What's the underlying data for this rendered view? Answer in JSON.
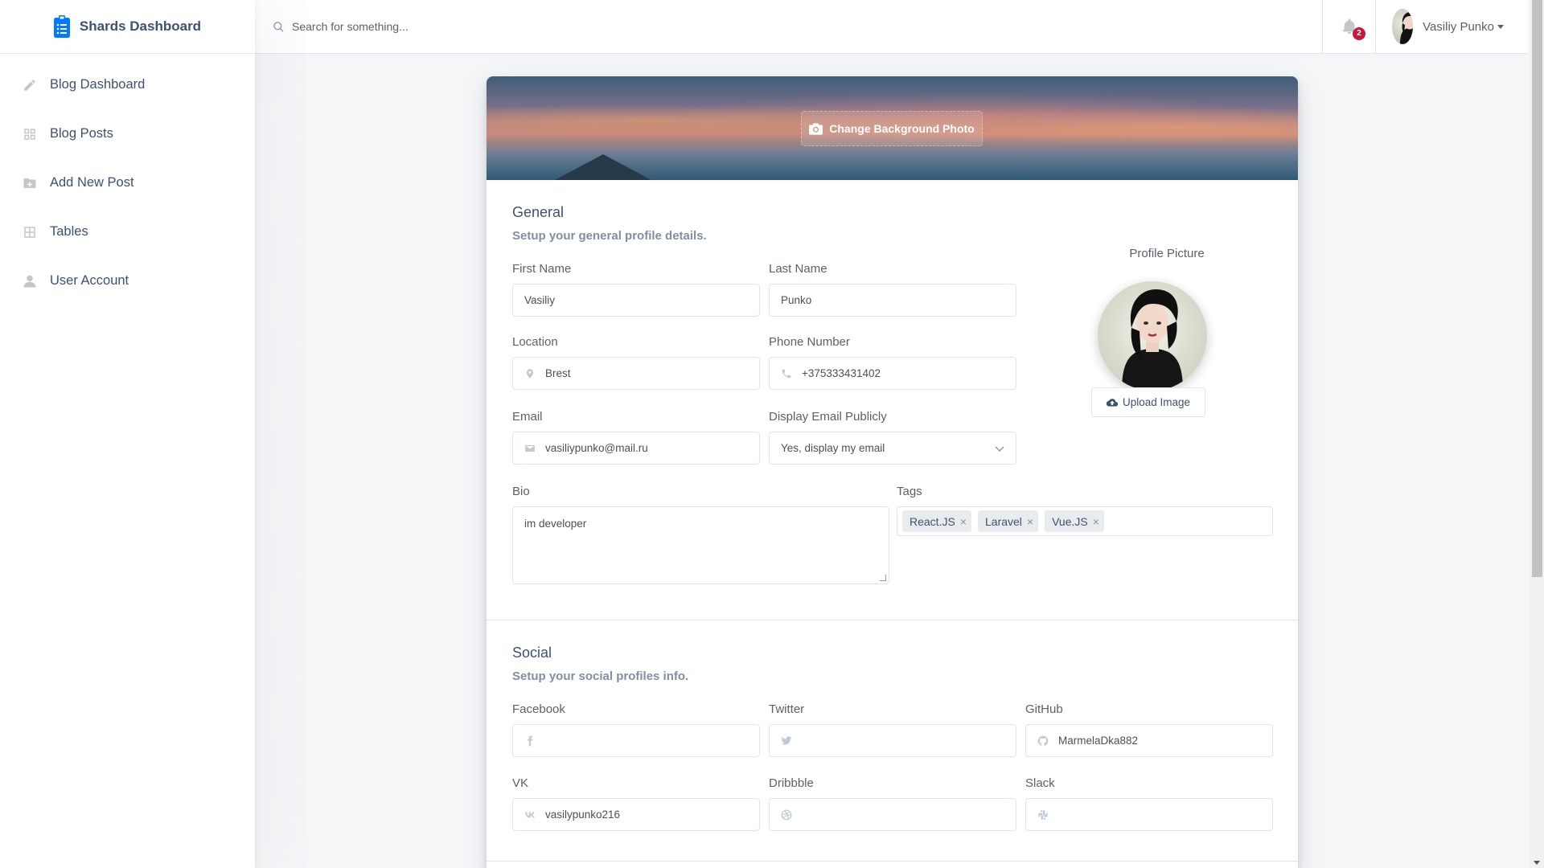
{
  "brand": {
    "name": "Shards Dashboard"
  },
  "sidebar": {
    "items": [
      {
        "label": "Blog Dashboard",
        "icon": "pencil-icon"
      },
      {
        "label": "Blog Posts",
        "icon": "grid-icon"
      },
      {
        "label": "Add New Post",
        "icon": "folder-plus-icon"
      },
      {
        "label": "Tables",
        "icon": "table-icon"
      },
      {
        "label": "User Account",
        "icon": "person-icon"
      }
    ]
  },
  "topbar": {
    "search_placeholder": "Search for something...",
    "notification_count": "2",
    "user_name": "Vasiliy Punko"
  },
  "banner": {
    "change_bg_label": "Change Background Photo"
  },
  "general": {
    "title": "General",
    "subtitle": "Setup your general profile details.",
    "first_name_label": "First Name",
    "first_name_value": "Vasiliy",
    "last_name_label": "Last Name",
    "last_name_value": "Punko",
    "location_label": "Location",
    "location_value": "Brest",
    "phone_label": "Phone Number",
    "phone_value": "+375333431402",
    "email_label": "Email",
    "email_value": "vasiliypunko@mail.ru",
    "display_email_label": "Display Email Publicly",
    "display_email_value": "Yes, display my email",
    "bio_label": "Bio",
    "bio_value": "im developer",
    "tags_label": "Tags",
    "tags": [
      "React.JS",
      "Laravel",
      "Vue.JS"
    ],
    "profile_picture_label": "Profile Picture",
    "upload_label": "Upload Image"
  },
  "social": {
    "title": "Social",
    "subtitle": "Setup your social profiles info.",
    "facebook_label": "Facebook",
    "facebook_value": "",
    "twitter_label": "Twitter",
    "twitter_value": "",
    "github_label": "GitHub",
    "github_value": "MarmelaDka882",
    "vk_label": "VK",
    "vk_value": "vasilypunko216",
    "dribbble_label": "Dribbble",
    "dribbble_value": "",
    "slack_label": "Slack",
    "slack_value": ""
  },
  "colors": {
    "accent": "#007bff",
    "badge": "#c4183c",
    "text": "#3d5170"
  }
}
